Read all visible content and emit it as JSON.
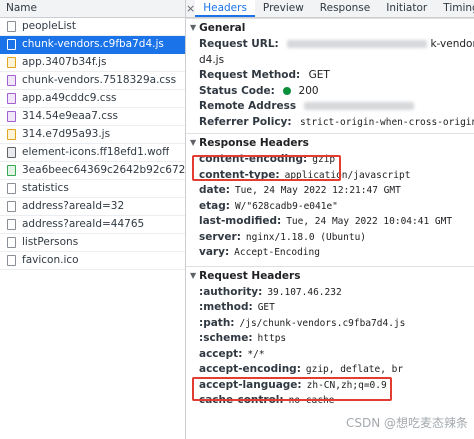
{
  "left": {
    "column_header": "Name",
    "requests": [
      {
        "name": "peopleList",
        "type": "doc",
        "icon": "document-icon",
        "selected": false
      },
      {
        "name": "chunk-vendors.c9fba7d4.js",
        "type": "js",
        "icon": "script-file-icon",
        "selected": true
      },
      {
        "name": "app.3407b34f.js",
        "type": "js",
        "icon": "script-file-icon",
        "selected": false
      },
      {
        "name": "chunk-vendors.7518329a.css",
        "type": "css",
        "icon": "stylesheet-file-icon",
        "selected": false
      },
      {
        "name": "app.a49cddc9.css",
        "type": "css",
        "icon": "stylesheet-file-icon",
        "selected": false
      },
      {
        "name": "314.54e9eaa7.css",
        "type": "css",
        "icon": "stylesheet-file-icon",
        "selected": false
      },
      {
        "name": "314.e7d95a93.js",
        "type": "js",
        "icon": "script-file-icon",
        "selected": false
      },
      {
        "name": "element-icons.ff18efd1.woff",
        "type": "font",
        "icon": "font-file-icon",
        "selected": false
      },
      {
        "name": "3ea6beec64369c2642b92c6726f1...",
        "type": "img",
        "icon": "image-file-icon",
        "selected": false
      },
      {
        "name": "statistics",
        "type": "doc",
        "icon": "document-icon",
        "selected": false
      },
      {
        "name": "address?areaId=32",
        "type": "doc",
        "icon": "document-icon",
        "selected": false
      },
      {
        "name": "address?areaId=44765",
        "type": "doc",
        "icon": "document-icon",
        "selected": false
      },
      {
        "name": "listPersons",
        "type": "doc",
        "icon": "document-icon",
        "selected": false
      },
      {
        "name": "favicon.ico",
        "type": "doc",
        "icon": "document-icon",
        "selected": false
      }
    ]
  },
  "tabs": {
    "close": "×",
    "items": [
      "Headers",
      "Preview",
      "Response",
      "Initiator",
      "Timing",
      "Cook"
    ],
    "active": "Headers"
  },
  "general": {
    "title": "General",
    "request_url_key": "Request URL:",
    "request_url_tail": "k-vendors.c9fba7d4.js",
    "request_url_line2": "d4.js",
    "request_method_key": "Request Method:",
    "request_method": "GET",
    "status_code_key": "Status Code:",
    "status_code": "200",
    "remote_address_key": "Remote Address",
    "referrer_policy_key": "Referrer Policy:",
    "referrer_policy": "strict-origin-when-cross-origin"
  },
  "response_headers": {
    "title": "Response Headers",
    "items": [
      {
        "key": "content-encoding:",
        "value": "gzip"
      },
      {
        "key": "content-type:",
        "value": "application/javascript"
      },
      {
        "key": "date:",
        "value": "Tue, 24 May 2022 12:21:47 GMT"
      },
      {
        "key": "etag:",
        "value": "W/\"628cadb9-e041e\""
      },
      {
        "key": "last-modified:",
        "value": "Tue, 24 May 2022 10:04:41 GMT"
      },
      {
        "key": "server:",
        "value": "nginx/1.18.0 (Ubuntu)"
      },
      {
        "key": "vary:",
        "value": "Accept-Encoding"
      }
    ]
  },
  "request_headers": {
    "title": "Request Headers",
    "items": [
      {
        "key": ":authority:",
        "value": "39.107.46.232"
      },
      {
        "key": ":method:",
        "value": "GET"
      },
      {
        "key": ":path:",
        "value": "/js/chunk-vendors.c9fba7d4.js"
      },
      {
        "key": ":scheme:",
        "value": "https"
      },
      {
        "key": "accept:",
        "value": "*/*"
      },
      {
        "key": "accept-encoding:",
        "value": "gzip, deflate, br"
      },
      {
        "key": "accept-language:",
        "value": "zh-CN,zh;q=0.9"
      },
      {
        "key": "cache-control:",
        "value": "no-cache"
      }
    ]
  },
  "watermark": "CSDN @想吃麦态辣条",
  "colors": {
    "highlight": "#e33c30",
    "selected_row": "#1a73e8",
    "status_ok": "#0a8f3b"
  }
}
